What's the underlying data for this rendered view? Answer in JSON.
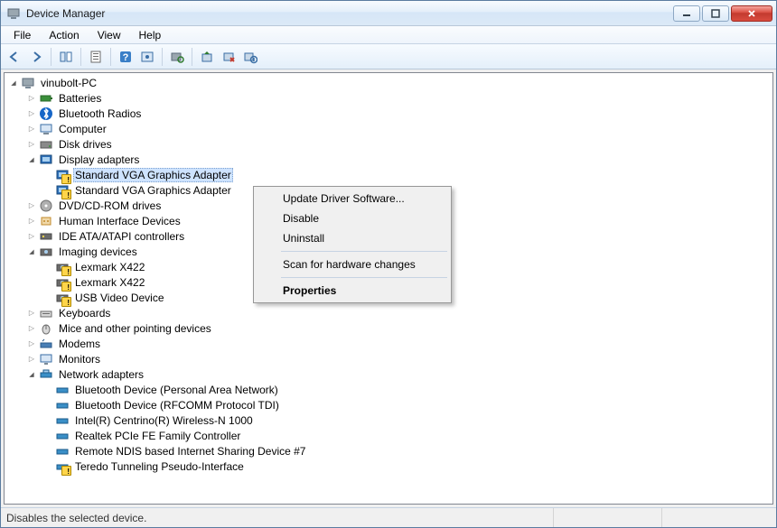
{
  "window": {
    "title": "Device Manager"
  },
  "menu": {
    "file": "File",
    "action": "Action",
    "view": "View",
    "help": "Help"
  },
  "tree": {
    "root": "vinubolt-PC",
    "batteries": "Batteries",
    "bluetooth": "Bluetooth Radios",
    "computer": "Computer",
    "disk": "Disk drives",
    "display": "Display adapters",
    "display_c0": "Standard VGA Graphics Adapter",
    "display_c1": "Standard VGA Graphics Adapter",
    "dvd": "DVD/CD-ROM drives",
    "hid": "Human Interface Devices",
    "ide": "IDE ATA/ATAPI controllers",
    "imaging": "Imaging devices",
    "imaging_c0": "Lexmark X422",
    "imaging_c1": "Lexmark X422",
    "imaging_c2": "USB Video Device",
    "keyboards": "Keyboards",
    "mice": "Mice and other pointing devices",
    "modems": "Modems",
    "monitors": "Monitors",
    "network": "Network adapters",
    "net_c0": "Bluetooth Device (Personal Area Network)",
    "net_c1": "Bluetooth Device (RFCOMM Protocol TDI)",
    "net_c2": "Intel(R) Centrino(R) Wireless-N 1000",
    "net_c3": "Realtek PCIe FE Family Controller",
    "net_c4": "Remote NDIS based Internet Sharing Device #7",
    "net_c5": "Teredo Tunneling Pseudo-Interface"
  },
  "context": {
    "update": "Update Driver Software...",
    "disable": "Disable",
    "uninstall": "Uninstall",
    "scan": "Scan for hardware changes",
    "properties": "Properties"
  },
  "status": {
    "text": "Disables the selected device."
  },
  "toolbar_icons": {
    "back": "back-arrow-icon",
    "forward": "forward-arrow-icon",
    "show_hide": "show-hide-tree-icon",
    "properties": "properties-icon",
    "help": "help-icon",
    "action": "action-icon",
    "scan": "scan-hardware-icon",
    "update": "update-driver-icon",
    "disable": "disable-device-icon",
    "uninstall": "uninstall-device-icon"
  }
}
